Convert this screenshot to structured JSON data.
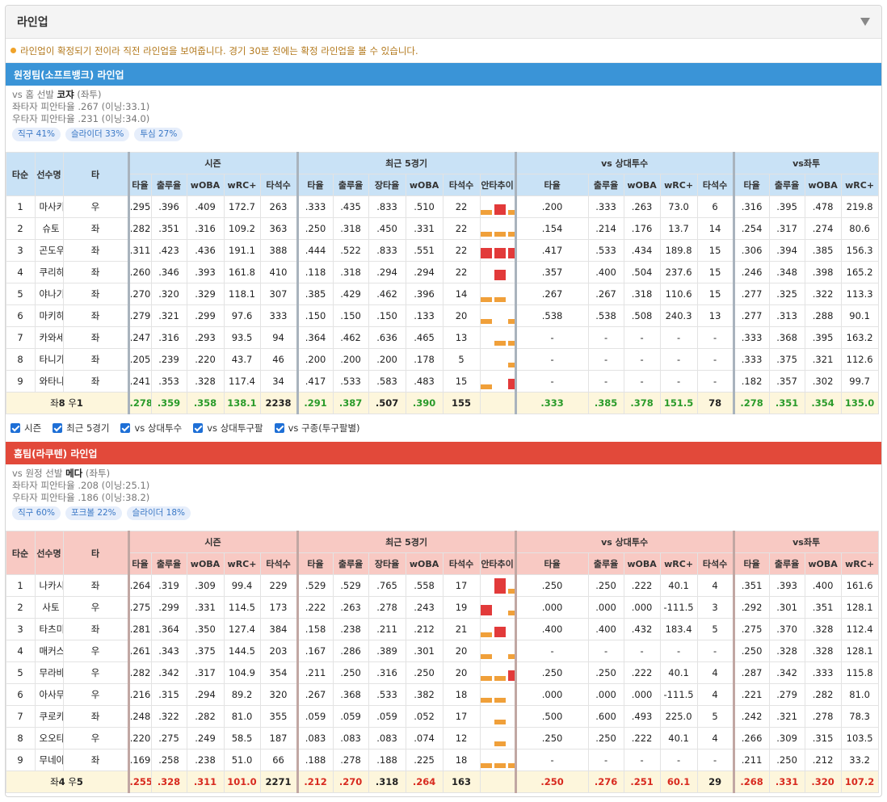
{
  "title": "라인업",
  "notice": "라인업이 확정되기 전이라 직전 라인업을 보여줍니다. 경기 30분 전에는 확정 라인업을 볼 수 있습니다.",
  "header_labels": {
    "order": "타순",
    "name": "선수명",
    "hand": "타",
    "groups": [
      "시즌",
      "최근 5경기",
      "vs 상대투수",
      "vs좌투"
    ],
    "season": [
      "타율",
      "출루율",
      "wOBA",
      "wRC+",
      "타석수"
    ],
    "recent": [
      "타율",
      "출루율",
      "장타율",
      "wOBA",
      "타석수",
      "안타추이"
    ],
    "vsp": [
      "타율",
      "출루율",
      "wOBA",
      "wRC+",
      "타석수"
    ],
    "vsl": [
      "타율",
      "출루율",
      "wOBA",
      "wRC+"
    ]
  },
  "away": {
    "title": "원정팀(소프트뱅크) 라인업",
    "pitcher_prefix": "vs 홈 선발 ",
    "pitcher_name": "코쟈",
    "pitcher_hand": " (좌투)",
    "line1": "좌타자 피안타율 .267 (이닝:33.1)",
    "line2": "우타자 피안타율 .231 (이닝:34.0)",
    "tags": [
      "직구 41%",
      "슬라이더 33%",
      "투심 27%"
    ],
    "rows": [
      {
        "n": "1",
        "name": "마사키",
        "h": "우",
        "s": [
          ".295",
          ".396",
          ".409",
          "172.7",
          "263"
        ],
        "r": [
          ".333",
          ".435",
          ".833",
          ".510",
          "22"
        ],
        "spark": [
          1,
          2,
          1,
          0,
          2
        ],
        "p": [
          ".200",
          ".333",
          ".263",
          "73.0",
          "6"
        ],
        "l": [
          ".316",
          ".395",
          ".478",
          "219.8"
        ]
      },
      {
        "n": "2",
        "name": "슈토",
        "h": "좌",
        "s": [
          ".282",
          ".351",
          ".316",
          "109.2",
          "363"
        ],
        "r": [
          ".250",
          ".318",
          ".450",
          ".331",
          "22"
        ],
        "spark": [
          1,
          1,
          1,
          1,
          2
        ],
        "p": [
          ".154",
          ".214",
          ".176",
          "13.7",
          "14"
        ],
        "l": [
          ".254",
          ".317",
          ".274",
          "80.6"
        ]
      },
      {
        "n": "3",
        "name": "곤도우",
        "h": "좌",
        "s": [
          ".311",
          ".423",
          ".436",
          "191.1",
          "388"
        ],
        "r": [
          ".444",
          ".522",
          ".833",
          ".551",
          "22"
        ],
        "spark": [
          2,
          2,
          2,
          1,
          2
        ],
        "p": [
          ".417",
          ".533",
          ".434",
          "189.8",
          "15"
        ],
        "l": [
          ".306",
          ".394",
          ".385",
          "156.3"
        ]
      },
      {
        "n": "4",
        "name": "쿠리하라",
        "h": "좌",
        "s": [
          ".260",
          ".346",
          ".393",
          "161.8",
          "410"
        ],
        "r": [
          ".118",
          ".318",
          ".294",
          ".294",
          "22"
        ],
        "spark": [
          0,
          2,
          0,
          0,
          0
        ],
        "p": [
          ".357",
          ".400",
          ".504",
          "237.6",
          "15"
        ],
        "l": [
          ".246",
          ".348",
          ".398",
          "165.2"
        ]
      },
      {
        "n": "5",
        "name": "야나기타",
        "h": "좌",
        "s": [
          ".270",
          ".320",
          ".329",
          "118.1",
          "307"
        ],
        "r": [
          ".385",
          ".429",
          ".462",
          ".396",
          "14"
        ],
        "spark": [
          1,
          1,
          0,
          0,
          3
        ],
        "p": [
          ".267",
          ".267",
          ".318",
          "110.6",
          "15"
        ],
        "l": [
          ".277",
          ".325",
          ".322",
          "113.3"
        ]
      },
      {
        "n": "6",
        "name": "마키하라",
        "h": "좌",
        "s": [
          ".279",
          ".321",
          ".299",
          "97.6",
          "333"
        ],
        "r": [
          ".150",
          ".150",
          ".150",
          ".133",
          "20"
        ],
        "spark": [
          1,
          0,
          1,
          1,
          0
        ],
        "p": [
          ".538",
          ".538",
          ".508",
          "240.3",
          "13"
        ],
        "l": [
          ".277",
          ".313",
          ".288",
          "90.1"
        ]
      },
      {
        "n": "7",
        "name": "카와세",
        "h": "좌",
        "s": [
          ".247",
          ".316",
          ".293",
          "93.5",
          "94"
        ],
        "r": [
          ".364",
          ".462",
          ".636",
          ".465",
          "13"
        ],
        "spark": [
          0,
          1,
          1,
          0,
          2
        ],
        "p": [
          "-",
          "-",
          "-",
          "-",
          "-"
        ],
        "l": [
          ".333",
          ".368",
          ".395",
          "163.2"
        ]
      },
      {
        "n": "8",
        "name": "타니가와라",
        "h": "좌",
        "s": [
          ".205",
          ".239",
          ".220",
          "43.7",
          "46"
        ],
        "r": [
          ".200",
          ".200",
          ".200",
          ".178",
          "5"
        ],
        "spark": [
          0,
          0,
          1,
          0,
          0
        ],
        "p": [
          "-",
          "-",
          "-",
          "-",
          "-"
        ],
        "l": [
          ".333",
          ".375",
          ".321",
          "112.6"
        ]
      },
      {
        "n": "9",
        "name": "와타나베",
        "h": "좌",
        "s": [
          ".241",
          ".353",
          ".328",
          "117.4",
          "34"
        ],
        "r": [
          ".417",
          ".533",
          ".583",
          ".483",
          "15"
        ],
        "spark": [
          1,
          0,
          2,
          2,
          0
        ],
        "p": [
          "-",
          "-",
          "-",
          "-",
          "-"
        ],
        "l": [
          ".182",
          ".357",
          ".302",
          "99.7"
        ]
      }
    ],
    "total": {
      "label_a": "좌",
      "label_b": "8",
      "label_c": " 우",
      "label_d": "1",
      "s": [
        ".278",
        ".359",
        ".358",
        "138.1",
        "2238"
      ],
      "r": [
        ".291",
        ".387",
        ".507",
        ".390",
        "155"
      ],
      "p": [
        ".333",
        ".385",
        ".378",
        "151.5",
        "78"
      ],
      "l": [
        ".278",
        ".351",
        ".354",
        "135.0"
      ]
    }
  },
  "checkboxes": [
    "시즌",
    "최근 5경기",
    "vs 상대투수",
    "vs 상대투구팔",
    "vs 구종(투구팔별)"
  ],
  "home": {
    "title": "홈팀(라쿠텐) 라인업",
    "pitcher_prefix": "vs 원정 선발 ",
    "pitcher_name": "메다",
    "pitcher_hand": " (좌투)",
    "line1": "좌타자 피안타율 .208 (이닝:25.1)",
    "line2": "우타자 피안타율 .186 (이닝:38.2)",
    "tags": [
      "직구 60%",
      "포크볼 22%",
      "슬라이더 18%"
    ],
    "rows": [
      {
        "n": "1",
        "name": "나카시마",
        "h": "좌",
        "s": [
          ".264",
          ".319",
          ".309",
          "99.4",
          "229"
        ],
        "r": [
          ".529",
          ".529",
          ".765",
          ".558",
          "17"
        ],
        "spark": [
          0,
          3,
          1,
          0,
          2
        ],
        "p": [
          ".250",
          ".250",
          ".222",
          "40.1",
          "4"
        ],
        "l": [
          ".351",
          ".393",
          ".400",
          "161.6"
        ]
      },
      {
        "n": "2",
        "name": "사토",
        "h": "우",
        "s": [
          ".275",
          ".299",
          ".331",
          "114.5",
          "173"
        ],
        "r": [
          ".222",
          ".263",
          ".278",
          ".243",
          "19"
        ],
        "spark": [
          2,
          0,
          1,
          1,
          1
        ],
        "p": [
          ".000",
          ".000",
          ".000",
          "-111.5",
          "3"
        ],
        "l": [
          ".292",
          ".301",
          ".351",
          "128.1"
        ]
      },
      {
        "n": "3",
        "name": "타츠미",
        "h": "좌",
        "s": [
          ".281",
          ".364",
          ".350",
          "127.4",
          "384"
        ],
        "r": [
          ".158",
          ".238",
          ".211",
          ".212",
          "21"
        ],
        "spark": [
          1,
          2,
          0,
          0,
          0
        ],
        "p": [
          ".400",
          ".400",
          ".432",
          "183.4",
          "5"
        ],
        "l": [
          ".275",
          ".370",
          ".328",
          "112.4"
        ]
      },
      {
        "n": "4",
        "name": "매커스커",
        "h": "우",
        "s": [
          ".261",
          ".343",
          ".375",
          "144.5",
          "203"
        ],
        "r": [
          ".167",
          ".286",
          ".389",
          ".301",
          "20"
        ],
        "spark": [
          1,
          0,
          1,
          1,
          0
        ],
        "p": [
          "-",
          "-",
          "-",
          "-",
          "-"
        ],
        "l": [
          ".250",
          ".328",
          ".328",
          "128.1"
        ]
      },
      {
        "n": "5",
        "name": "무라바야시",
        "h": "우",
        "s": [
          ".282",
          ".342",
          ".317",
          "104.9",
          "354"
        ],
        "r": [
          ".211",
          ".250",
          ".316",
          ".250",
          "20"
        ],
        "spark": [
          1,
          1,
          2,
          0,
          0
        ],
        "p": [
          ".250",
          ".250",
          ".222",
          "40.1",
          "4"
        ],
        "l": [
          ".287",
          ".342",
          ".333",
          "115.8"
        ]
      },
      {
        "n": "6",
        "name": "아사무라",
        "h": "우",
        "s": [
          ".216",
          ".315",
          ".294",
          "89.2",
          "320"
        ],
        "r": [
          ".267",
          ".368",
          ".533",
          ".382",
          "18"
        ],
        "spark": [
          1,
          1,
          0,
          3,
          0
        ],
        "p": [
          ".000",
          ".000",
          ".000",
          "-111.5",
          "4"
        ],
        "l": [
          ".221",
          ".279",
          ".282",
          "81.0"
        ]
      },
      {
        "n": "7",
        "name": "쿠로카와",
        "h": "좌",
        "s": [
          ".248",
          ".322",
          ".282",
          "81.0",
          "355"
        ],
        "r": [
          ".059",
          ".059",
          ".059",
          ".052",
          "17"
        ],
        "spark": [
          0,
          1,
          0,
          0,
          0
        ],
        "p": [
          ".500",
          ".600",
          ".493",
          "225.0",
          "5"
        ],
        "l": [
          ".242",
          ".321",
          ".278",
          "78.3"
        ]
      },
      {
        "n": "8",
        "name": "오오타",
        "h": "우",
        "s": [
          ".220",
          ".275",
          ".249",
          "58.5",
          "187"
        ],
        "r": [
          ".083",
          ".083",
          ".083",
          ".074",
          "12"
        ],
        "spark": [
          0,
          1,
          0,
          0,
          0
        ],
        "p": [
          ".250",
          ".250",
          ".222",
          "40.1",
          "4"
        ],
        "l": [
          ".266",
          ".309",
          ".315",
          "103.5"
        ]
      },
      {
        "n": "9",
        "name": "무네야마",
        "h": "좌",
        "s": [
          ".169",
          ".258",
          ".238",
          "51.0",
          "66"
        ],
        "r": [
          ".188",
          ".278",
          ".188",
          ".225",
          "18"
        ],
        "spark": [
          1,
          1,
          1,
          0,
          0
        ],
        "p": [
          "-",
          "-",
          "-",
          "-",
          "-"
        ],
        "l": [
          ".211",
          ".250",
          ".212",
          "33.2"
        ]
      }
    ],
    "total": {
      "label_a": "좌",
      "label_b": "4",
      "label_c": " 우",
      "label_d": "5",
      "s": [
        ".255",
        ".328",
        ".311",
        "101.0",
        "2271"
      ],
      "r": [
        ".212",
        ".270",
        ".318",
        ".264",
        "163"
      ],
      "p": [
        ".250",
        ".276",
        ".251",
        "60.1",
        "29"
      ],
      "l": [
        ".268",
        ".331",
        ".320",
        "107.2"
      ]
    }
  },
  "colors": {
    "away_bar": "#3a94d7",
    "home_bar": "#e2493a",
    "spark_single": "#f0a03a",
    "spark_xbh": "#e23a3a",
    "away_total": "#2a9b2a",
    "home_total": "#d82a1f"
  }
}
